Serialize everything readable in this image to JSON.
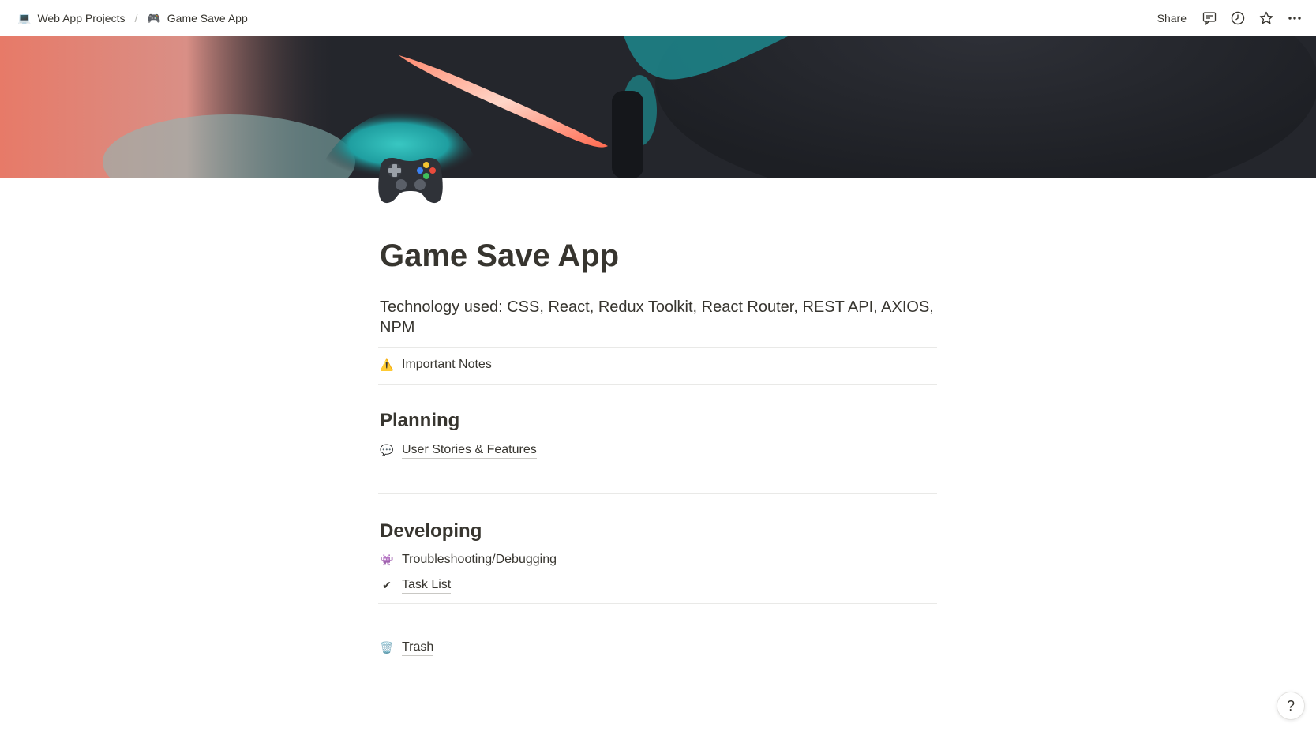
{
  "breadcrumb": {
    "items": [
      {
        "icon": "laptop-icon",
        "label": "Web App Projects"
      },
      {
        "icon": "game-controller-icon",
        "label": "Game Save App"
      }
    ],
    "separator": "/"
  },
  "topbar": {
    "share_label": "Share",
    "icons": [
      "comments-icon",
      "history-clock-icon",
      "favorite-star-icon",
      "more-options-icon"
    ]
  },
  "page": {
    "icon": "game-controller-icon",
    "title": "Game Save App",
    "technology": "Technology used: CSS, React, Redux Toolkit, React Router, REST API, AXIOS, NPM"
  },
  "links": {
    "important_notes": {
      "icon": "warning-icon",
      "label": "Important Notes"
    },
    "user_stories": {
      "icon": "speech-balloon-icon",
      "label": "User Stories & Features"
    },
    "troubleshooting": {
      "icon": "space-invader-icon",
      "label": "Troubleshooting/Debugging"
    },
    "task_list": {
      "icon": "checkmark-icon",
      "label": "Task List"
    },
    "trash": {
      "icon": "wastebasket-icon",
      "label": "Trash"
    }
  },
  "sections": {
    "planning": "Planning",
    "developing": "Developing"
  },
  "help": {
    "label": "?"
  },
  "colors": {
    "text": "#37352f",
    "divider": "#e9e9e7",
    "cover_dark": "#23252b",
    "cover_coral": "#e8735f",
    "cover_teal": "#2fb6b4"
  }
}
